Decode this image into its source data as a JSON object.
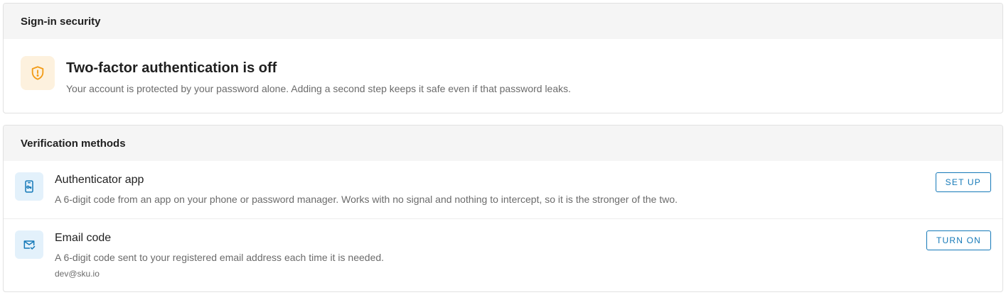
{
  "sign_in_security": {
    "header": "Sign-in security",
    "status": {
      "icon": "shield-alert-icon",
      "title": "Two-factor authentication is off",
      "description": "Your account is protected by your password alone. Adding a second step keeps it safe even if that password leaks."
    }
  },
  "verification_methods": {
    "header": "Verification methods",
    "methods": [
      {
        "icon": "phone-key-icon",
        "name": "Authenticator app",
        "description": "A 6-digit code from an app on your phone or password manager. Works with no signal and nothing to intercept, so it is the stronger of the two.",
        "action_label": "SET UP"
      },
      {
        "icon": "email-check-icon",
        "name": "Email code",
        "description": "A 6-digit code sent to your registered email address each time it is needed.",
        "detail": "dev@sku.io",
        "action_label": "TURN ON"
      }
    ]
  },
  "colors": {
    "warning_icon": "#f29b16",
    "warning_bg": "#fdf1de",
    "accent": "#1579b8",
    "accent_bg": "#e3f1fb",
    "header_bg": "#f5f5f5"
  }
}
